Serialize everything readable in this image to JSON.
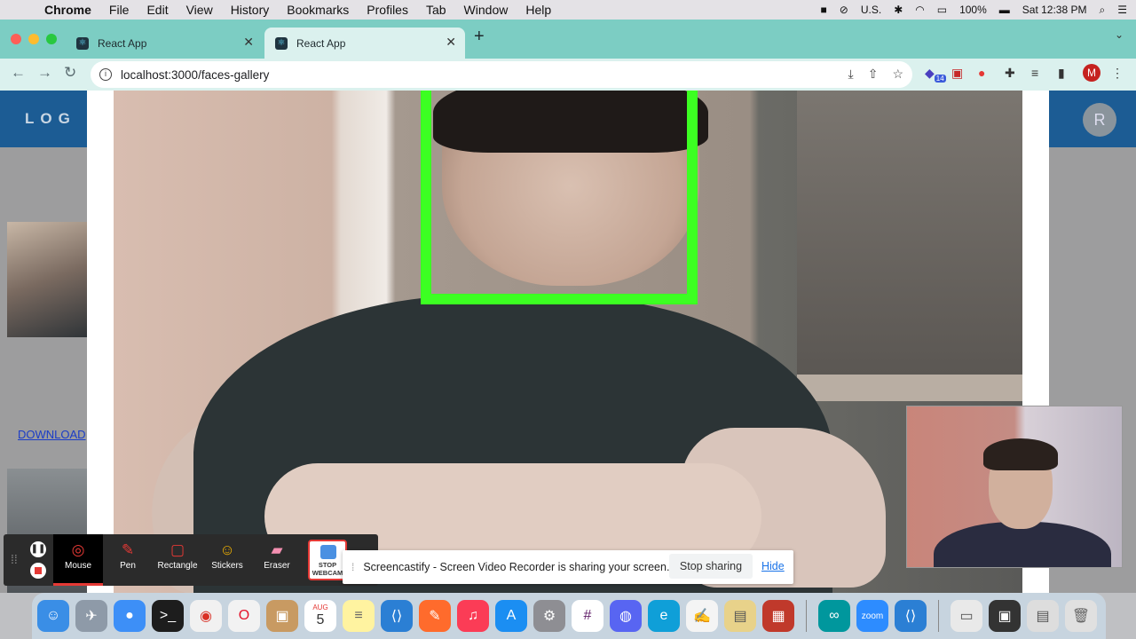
{
  "menubar": {
    "app": "Chrome",
    "items": [
      "File",
      "Edit",
      "View",
      "History",
      "Bookmarks",
      "Profiles",
      "Tab",
      "Window",
      "Help"
    ],
    "input_source": "U.S.",
    "battery": "100%",
    "clock": "Sat 12:38 PM"
  },
  "tabs": [
    {
      "title": "React App"
    },
    {
      "title": "React App"
    }
  ],
  "toolbar": {
    "url": "localhost:3000/faces-gallery",
    "profile_initial": "M",
    "extension_badge": "14"
  },
  "app": {
    "logo_text": "LOG",
    "user_initial": "R",
    "download_link": "DOWNLOAD"
  },
  "screencastify": {
    "tools": [
      {
        "label": "Mouse",
        "icon": "mouse-cursor-icon",
        "active": true
      },
      {
        "label": "Pen",
        "icon": "pen-icon",
        "active": false
      },
      {
        "label": "Rectangle",
        "icon": "rectangle-icon",
        "active": false
      },
      {
        "label": "Stickers",
        "icon": "sticker-icon",
        "active": false
      },
      {
        "label": "Eraser",
        "icon": "eraser-icon",
        "active": false
      }
    ],
    "webcam_button": "STOP WEBCAM"
  },
  "sharing": {
    "message": "Screencastify - Screen Video Recorder is sharing your screen.",
    "stop_label": "Stop sharing",
    "hide_label": "Hide"
  },
  "dock": {
    "calendar_month": "AUG",
    "calendar_day": "5",
    "zoom_label": "zoom"
  },
  "colors": {
    "tab_strip": "#7ccdc3",
    "app_header": "#1c5c94",
    "face_box": "#3cff22",
    "record_red": "#e53935"
  }
}
